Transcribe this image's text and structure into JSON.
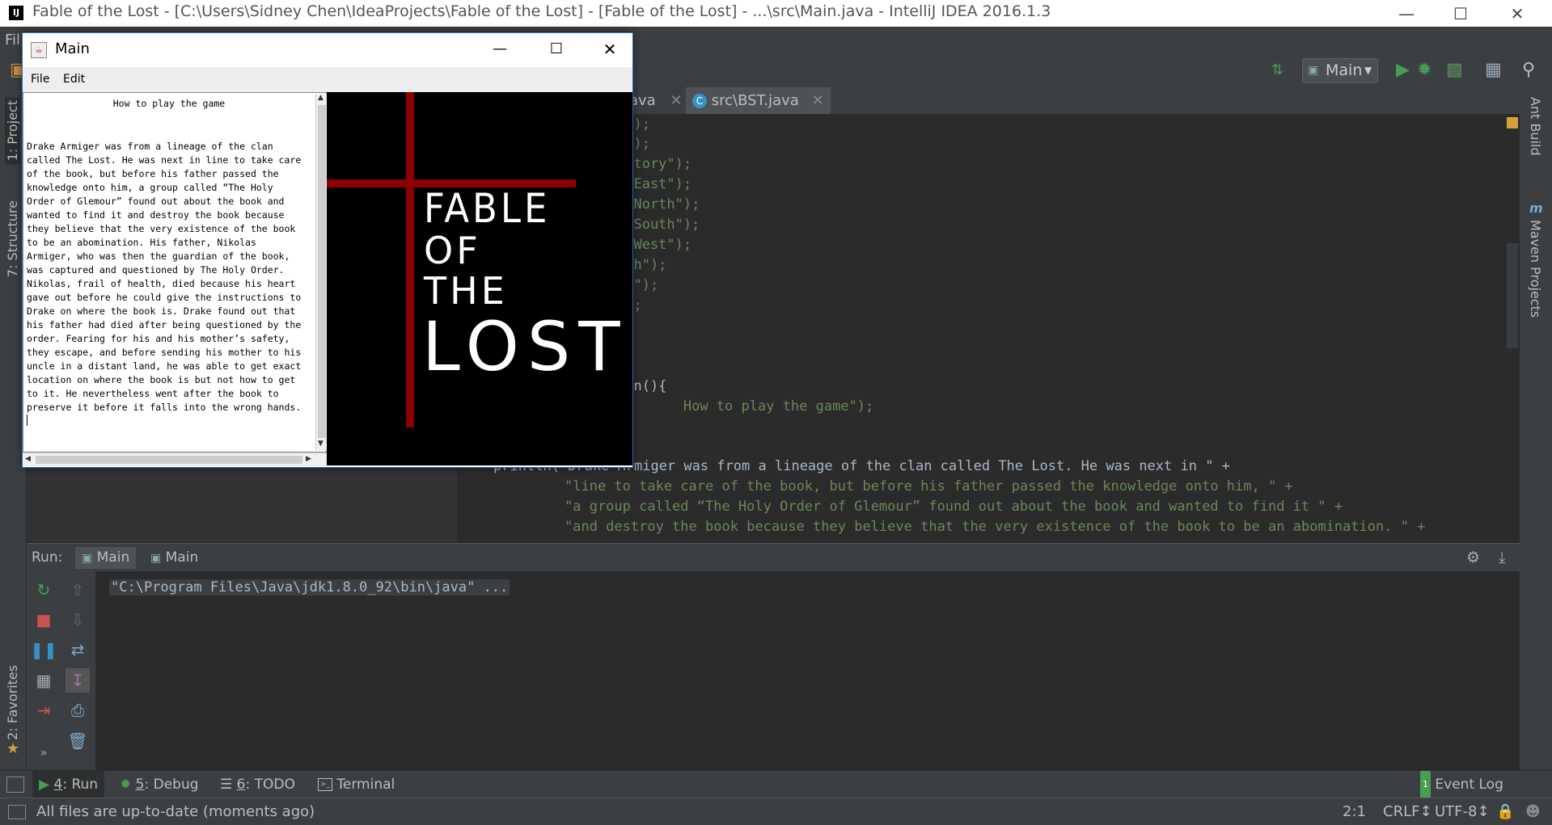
{
  "ide": {
    "title": "Fable of the Lost - [C:\\Users\\Sidney Chen\\IdeaProjects\\Fable of the Lost] - [Fable of the Lost] - ...\\src\\Main.java - IntelliJ IDEA 2016.1.3",
    "menu_first": "Fil",
    "run_config": "Main",
    "tabs": [
      {
        "label": "ava"
      },
      {
        "label": "src\\BST.java"
      }
    ],
    "left_stripe": [
      "1: Project",
      "7: Structure",
      "2: Favorites"
    ],
    "right_stripe": [
      "Ant Build",
      "Maven Projects"
    ],
    "code_lines": [
      {
        "text": "o\");"
      },
      {
        "text": "t\");"
      },
      {
        "text": "entory\");"
      },
      {
        "text": "e East\");"
      },
      {
        "text": "e North\");"
      },
      {
        "text": "e South\");"
      },
      {
        "text": "e West\");"
      },
      {
        "text": "tch\");"
      },
      {
        "text": "ct\");"
      },
      {
        "text": "\");"
      },
      {
        "text": "een(){"
      },
      {
        "text": "        How to play the game\");"
      }
    ],
    "code_lower": [
      "println(\"Drake Armiger was from a lineage of the clan called The Lost. He was next in \" +",
      "\"line to take care of the book, but before his father passed the knowledge onto him, \" +",
      "\"a group called “The Holy Order of Glemour” found out about the book and wanted to find it \" +",
      "\"and destroy the book because they believe that the very existence of the book to be an abomination. \" +"
    ]
  },
  "run": {
    "label": "Run:",
    "tabs": [
      "Main",
      "Main"
    ],
    "console": "\"C:\\Program Files\\Java\\jdk1.8.0_92\\bin\\java\" ..."
  },
  "bottom_tools": [
    {
      "num": "4",
      "label": ": Run"
    },
    {
      "num": "5",
      "label": ": Debug"
    },
    {
      "num": "6",
      "label": ": TODO"
    },
    {
      "num": "",
      "label": "Terminal"
    }
  ],
  "event_log": "Event Log",
  "event_log_count": "1",
  "status": {
    "message": "All files are up-to-date (moments ago)",
    "position": "2:1",
    "line_sep": "CRLF↕",
    "encoding": "UTF-8↕"
  },
  "java_window": {
    "title": "Main",
    "menu": [
      "File",
      "Edit"
    ],
    "text_title": "How to play the game",
    "story": "Drake Armiger was from a lineage of the clan\ncalled The Lost. He was next in line to take care\nof the book, but before his father passed the\nknowledge onto him, a group called “The Holy\nOrder of Glemour” found out about the book and\nwanted to find it and destroy the book because\nthey believe that the very existence of the book\nto be an abomination. His father, Nikolas\nArmiger, who was then the guardian of the book,\nwas captured and questioned by The Holy Order.\nNikolas, frail of health, died because his heart\ngave out before he could give the instructions to\nDrake on where the book is. Drake found out that\nhis father had died after being questioned by the\norder. Fearing for his and his mother’s safety,\nthey escape, and before sending his mother to his\nuncle in a distant land, he was able to get exact\nlocation on where the book is but not how to get\nto it. He nevertheless went after the book to\npreserve it before it falls into the wrong hands.",
    "logo": {
      "line1": "FABLE",
      "line2": "OF",
      "line3": "THE",
      "line4": "LOST"
    }
  },
  "colors": {
    "cross": "#8b0000",
    "logo_text": "#ffffff",
    "accent_green": "#499c54"
  }
}
